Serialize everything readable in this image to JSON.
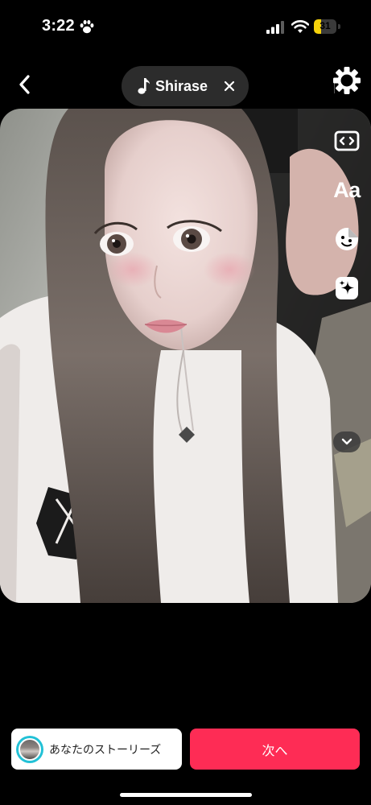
{
  "status_bar": {
    "time": "3:22",
    "battery_level": "31",
    "battery_fraction": 0.31,
    "icons": [
      "paw-icon",
      "signal-icon",
      "wifi-icon",
      "battery-icon"
    ]
  },
  "header": {
    "sound_name": "Shirase",
    "icons": [
      "back-arrow-icon",
      "music-note-icon",
      "close-icon",
      "gear-icon"
    ]
  },
  "side_tools": {
    "text_label": "Aa",
    "icons": [
      "aspect-ratio-icon",
      "sticker-icon",
      "effects-sparkle-icon",
      "chevron-down-icon"
    ]
  },
  "bottom": {
    "stories_label": "あなたのストーリーズ",
    "next_label": "次へ"
  },
  "colors": {
    "accent": "#fe2c55",
    "battery": "#f6d20a",
    "avatar_ring": "#22c1d6",
    "pill": "#2c2c2c"
  }
}
